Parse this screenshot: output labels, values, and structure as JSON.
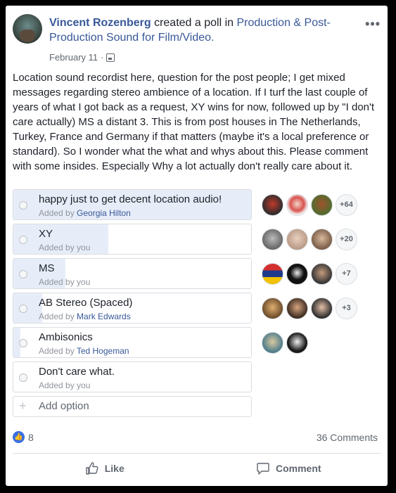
{
  "post": {
    "author": "Vincent Rozenberg",
    "action_text": " created a poll in ",
    "group": "Production & Post-Production Sound for Film/Video.",
    "date": "February 11",
    "date_separator": "·",
    "more_label": "•••",
    "body": "Location sound recordist here, question for the post people; I get mixed messages regarding stereo ambience of a location. If I turf the last couple of years of what I got back as a request, XY wins for now, followed up by \"I don't care actually) MS a distant 3. This is from post houses in The Netherlands, Turkey, France and Germany if that matters (maybe it's a local preference or standard). So I wonder what the what and whys about this. Please comment with some insides. Especially Why a lot actually don't really care about it."
  },
  "poll": {
    "options": [
      {
        "label": "happy just to get decent location audio!",
        "added_prefix": "Added by ",
        "added_by": "Georgia Hilton",
        "vote_share": 1.0,
        "more_voters": "+64"
      },
      {
        "label": "XY",
        "added_prefix": "Added by you",
        "added_by": "",
        "vote_share": 0.4,
        "more_voters": "+20"
      },
      {
        "label": "MS",
        "added_prefix": "Added by you",
        "added_by": "",
        "vote_share": 0.22,
        "more_voters": "+7"
      },
      {
        "label": "AB Stereo (Spaced)",
        "added_prefix": "Added by ",
        "added_by": "Mark Edwards",
        "vote_share": 0.12,
        "more_voters": "+3"
      },
      {
        "label": "Ambisonics",
        "added_prefix": "Added by ",
        "added_by": "Ted Hogeman",
        "vote_share": 0.03,
        "more_voters": ""
      },
      {
        "label": "Don't care what.",
        "added_prefix": "Added by you",
        "added_by": "",
        "vote_share": 0.0,
        "more_voters": ""
      }
    ],
    "add_option_label": "Add option",
    "add_option_icon": "+"
  },
  "stats": {
    "likes": "8",
    "like_icon": "👍",
    "comments": "36 Comments"
  },
  "actions": {
    "like_label": "Like",
    "comment_label": "Comment"
  },
  "colors": {
    "link": "#385898",
    "fill": "#e7edf8",
    "like_badge": "#3b6fe0"
  }
}
